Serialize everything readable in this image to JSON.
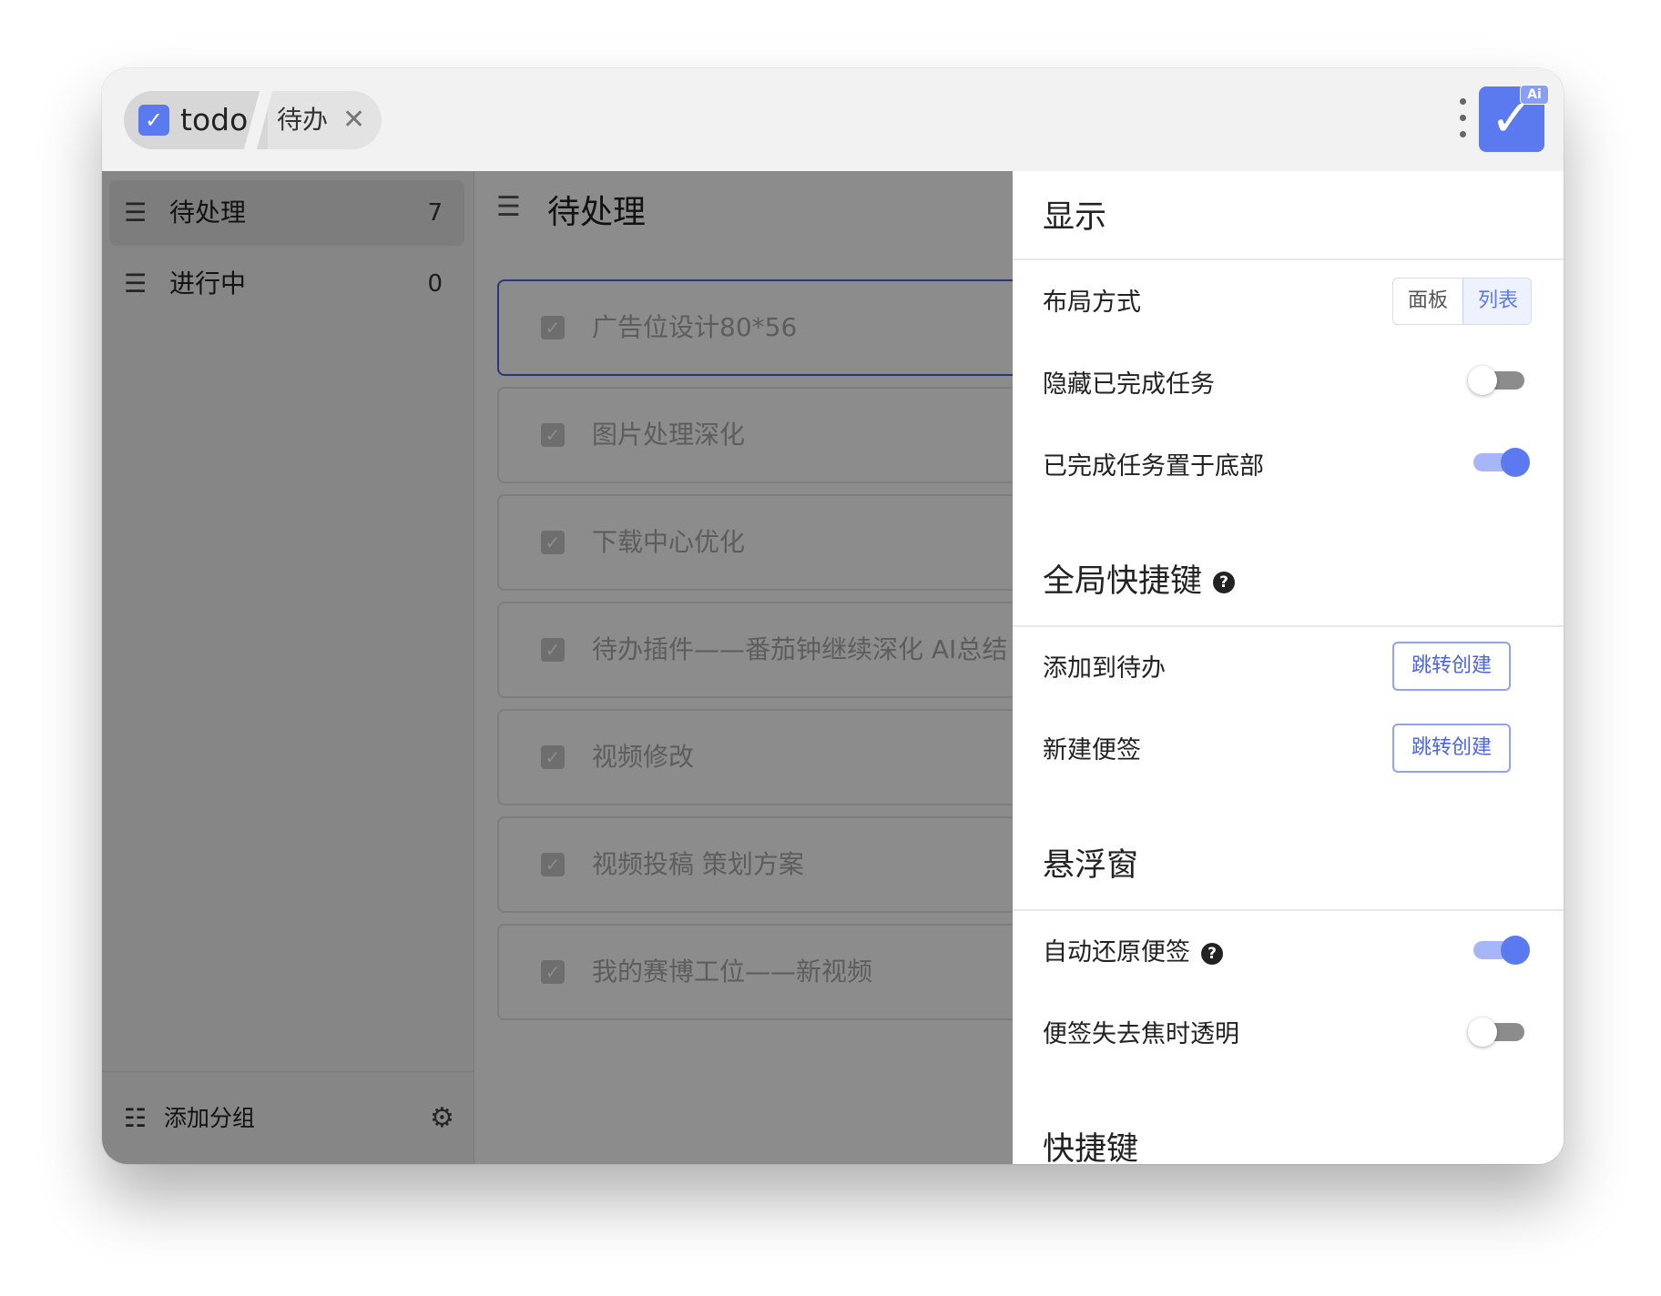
{
  "app": {
    "name": "todo",
    "tab_title": "待办",
    "tab_close": "✕",
    "logo_badge": "Ai",
    "accent": "#5b7af0"
  },
  "sidebar": {
    "groups": [
      {
        "label": "待处理",
        "count": "7",
        "active": true
      },
      {
        "label": "进行中",
        "count": "0",
        "active": false
      }
    ],
    "add_group_label": "添加分组"
  },
  "main": {
    "title": "待处理",
    "tasks": [
      {
        "text": "广告位设计80*56"
      },
      {
        "text": "图片处理深化"
      },
      {
        "text": "下载中心优化"
      },
      {
        "text": "待办插件——番茄钟继续深化   AI总结"
      },
      {
        "text": "视频修改"
      },
      {
        "text": "视频投稿 策划方案"
      },
      {
        "text": "我的赛博工位——新视频"
      }
    ]
  },
  "settings": {
    "display": {
      "title": "显示",
      "layout_label": "布局方式",
      "layout_options": [
        "面板",
        "列表"
      ],
      "layout_selected": "列表",
      "hide_completed_label": "隐藏已完成任务",
      "hide_completed": false,
      "completed_bottom_label": "已完成任务置于底部",
      "completed_bottom": true
    },
    "global_shortcuts": {
      "title": "全局快捷键",
      "add_todo_label": "添加到待办",
      "add_todo_button": "跳转创建",
      "new_note_label": "新建便签",
      "new_note_button": "跳转创建"
    },
    "floating": {
      "title": "悬浮窗",
      "auto_restore_label": "自动还原便签",
      "auto_restore": true,
      "transparent_label": "便签失去焦时透明",
      "transparent": false
    },
    "shortcuts": {
      "title": "快捷键"
    }
  }
}
